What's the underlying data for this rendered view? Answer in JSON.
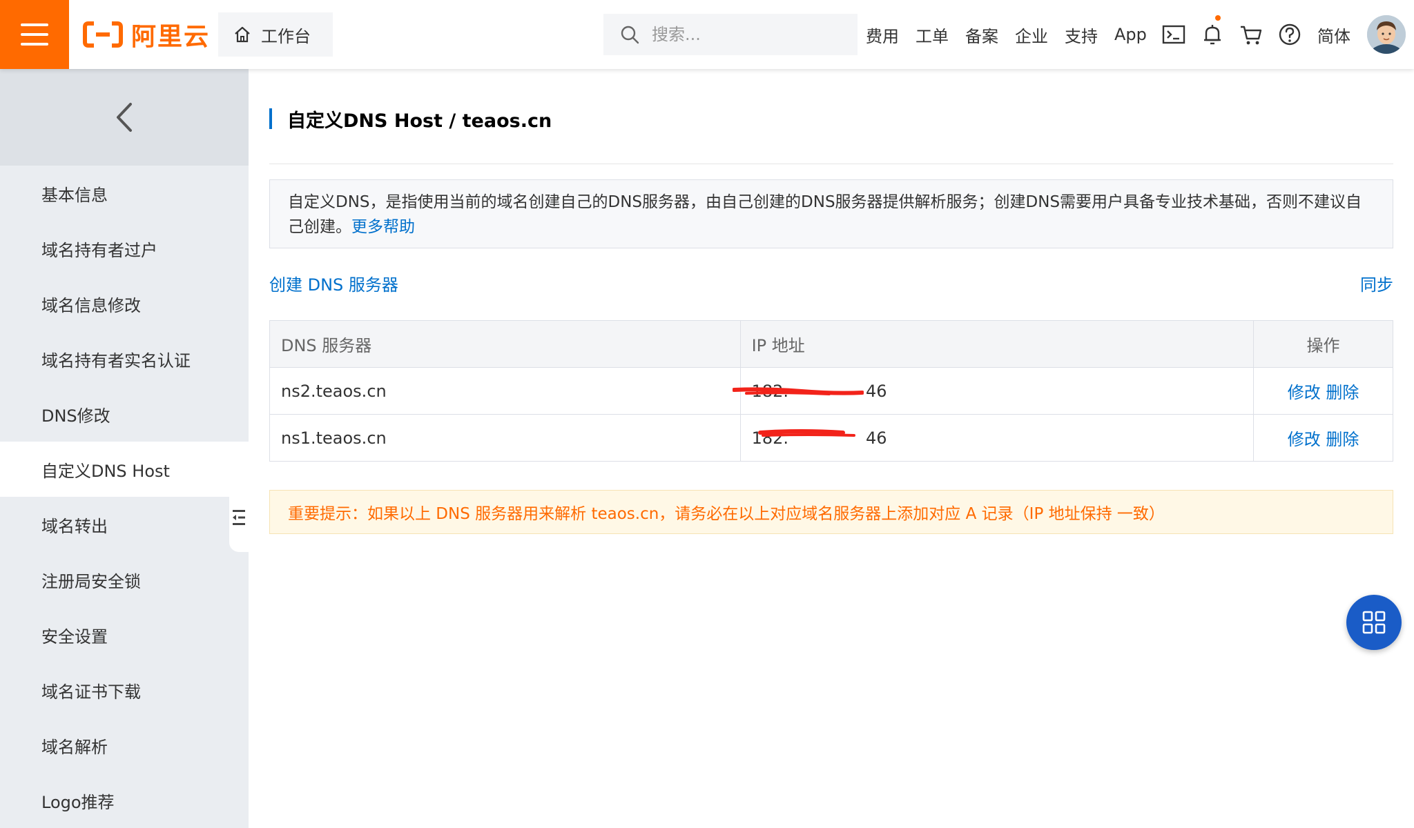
{
  "header": {
    "brand": "阿里云",
    "workbench_label": "工作台",
    "search_placeholder": "搜索...",
    "nav": [
      "费用",
      "工单",
      "备案",
      "企业",
      "支持",
      "App"
    ],
    "language": "简体",
    "icons": [
      "menu-icon",
      "home-icon",
      "search-icon",
      "terminal-icon",
      "bell-icon",
      "cart-icon",
      "help-icon"
    ],
    "accent_color": "#ff6a00"
  },
  "sidebar": {
    "items": [
      {
        "label": "基本信息"
      },
      {
        "label": "域名持有者过户"
      },
      {
        "label": "域名信息修改"
      },
      {
        "label": "域名持有者实名认证"
      },
      {
        "label": "DNS修改"
      },
      {
        "label": "自定义DNS Host",
        "active": true
      },
      {
        "label": "域名转出"
      },
      {
        "label": "注册局安全锁"
      },
      {
        "label": "安全设置"
      },
      {
        "label": "域名证书下载"
      },
      {
        "label": "域名解析"
      },
      {
        "label": "Logo推荐"
      }
    ]
  },
  "main": {
    "title": "自定义DNS Host / teaos.cn",
    "info_text": "自定义DNS，是指使用当前的域名创建自己的DNS服务器，由自己创建的DNS服务器提供解析服务；创建DNS需要用户具备专业技术基础，否则不建议自己创建。",
    "info_link": "更多帮助",
    "create_link": "创建 DNS 服务器",
    "sync_link": "同步",
    "table": {
      "headers": [
        "DNS 服务器",
        "IP 地址",
        "操作"
      ],
      "rows": [
        {
          "server": "ns2.teaos.cn",
          "ip": "182.",
          "ip_tail": "46",
          "edit": "修改",
          "delete": "删除"
        },
        {
          "server": "ns1.teaos.cn",
          "ip": "182.",
          "ip_tail": "46",
          "edit": "修改",
          "delete": "删除"
        }
      ]
    },
    "warning": "重要提示：如果以上 DNS 服务器用来解析 teaos.cn，请务必在以上对应域名服务器上添加对应 A 记录（IP 地址保持 一致）",
    "link_color": "#0070cc",
    "warning_color": "#ff6a00"
  }
}
